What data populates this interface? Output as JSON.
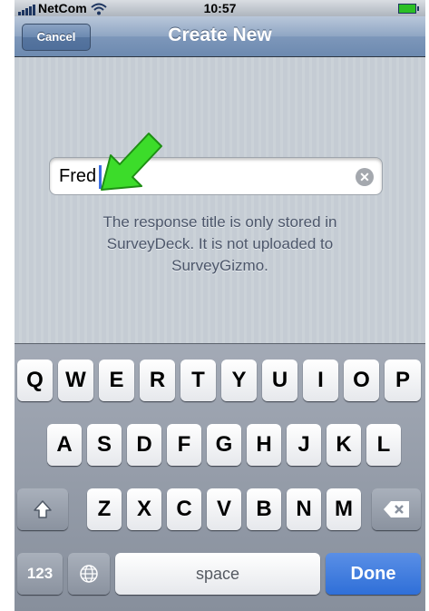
{
  "status_bar": {
    "carrier": "NetCom",
    "time": "10:57"
  },
  "nav_bar": {
    "title": "Create New",
    "cancel_label": "Cancel"
  },
  "title_field": {
    "value": "Fred"
  },
  "help_text": [
    "The response title is only stored in",
    "SurveyDeck. It is not uploaded to",
    "SurveyGizmo."
  ],
  "keyboard": {
    "row1": [
      "Q",
      "W",
      "E",
      "R",
      "T",
      "Y",
      "U",
      "I",
      "O",
      "P"
    ],
    "row2": [
      "A",
      "S",
      "D",
      "F",
      "G",
      "H",
      "J",
      "K",
      "L"
    ],
    "row3": [
      "Z",
      "X",
      "C",
      "V",
      "B",
      "N",
      "M"
    ],
    "numbers_label": "123",
    "space_label": "space",
    "done_label": "Done"
  },
  "colors": {
    "arrow": "#3cdc2a",
    "done_button": "#3d7be0",
    "nav_bar": "#7d97ba"
  },
  "icons": {
    "signal": "signal-bars-icon",
    "wifi": "wifi-icon",
    "battery": "battery-icon",
    "clear": "clear-text-icon",
    "shift": "shift-arrow-icon",
    "backspace": "backspace-icon",
    "globe": "globe-icon",
    "pointer": "green-arrow-icon"
  }
}
